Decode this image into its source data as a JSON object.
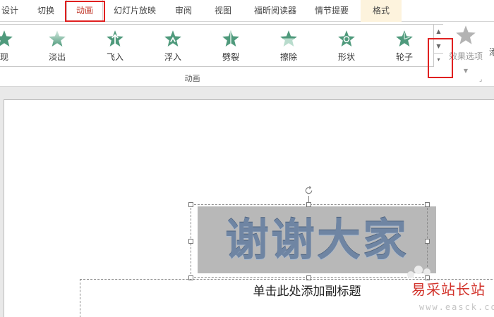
{
  "tabs": [
    {
      "label": "设计"
    },
    {
      "label": "切换"
    },
    {
      "label": "动画"
    },
    {
      "label": "幻灯片放映"
    },
    {
      "label": "审阅"
    },
    {
      "label": "视图"
    },
    {
      "label": "福昕阅读器"
    },
    {
      "label": "情节提要"
    },
    {
      "label": "格式"
    }
  ],
  "active_tab": "动画",
  "animations": [
    {
      "label": "现",
      "icon": "appear-star-icon"
    },
    {
      "label": "淡出",
      "icon": "fade-star-icon"
    },
    {
      "label": "飞入",
      "icon": "fly-in-star-icon"
    },
    {
      "label": "浮入",
      "icon": "float-in-star-icon"
    },
    {
      "label": "劈裂",
      "icon": "split-star-icon"
    },
    {
      "label": "擦除",
      "icon": "wipe-star-icon"
    },
    {
      "label": "形状",
      "icon": "shape-star-icon"
    },
    {
      "label": "轮子",
      "icon": "wheel-star-icon"
    }
  ],
  "effect_options": {
    "label": "效果选项",
    "icon": "star-icon"
  },
  "group_label": "动画",
  "slide": {
    "wordart_text": "谢谢大家",
    "subtitle_placeholder": "单击此处添加副标题"
  },
  "watermark": {
    "title": "易采站长站",
    "url": "www.easck.com"
  },
  "colors": {
    "highlight": "#e02020",
    "active_tab_text": "#c0392b",
    "format_tab_bg": "#fdf3dd",
    "star_green": "#4f9a7c",
    "wordart": "#6f85a3"
  }
}
